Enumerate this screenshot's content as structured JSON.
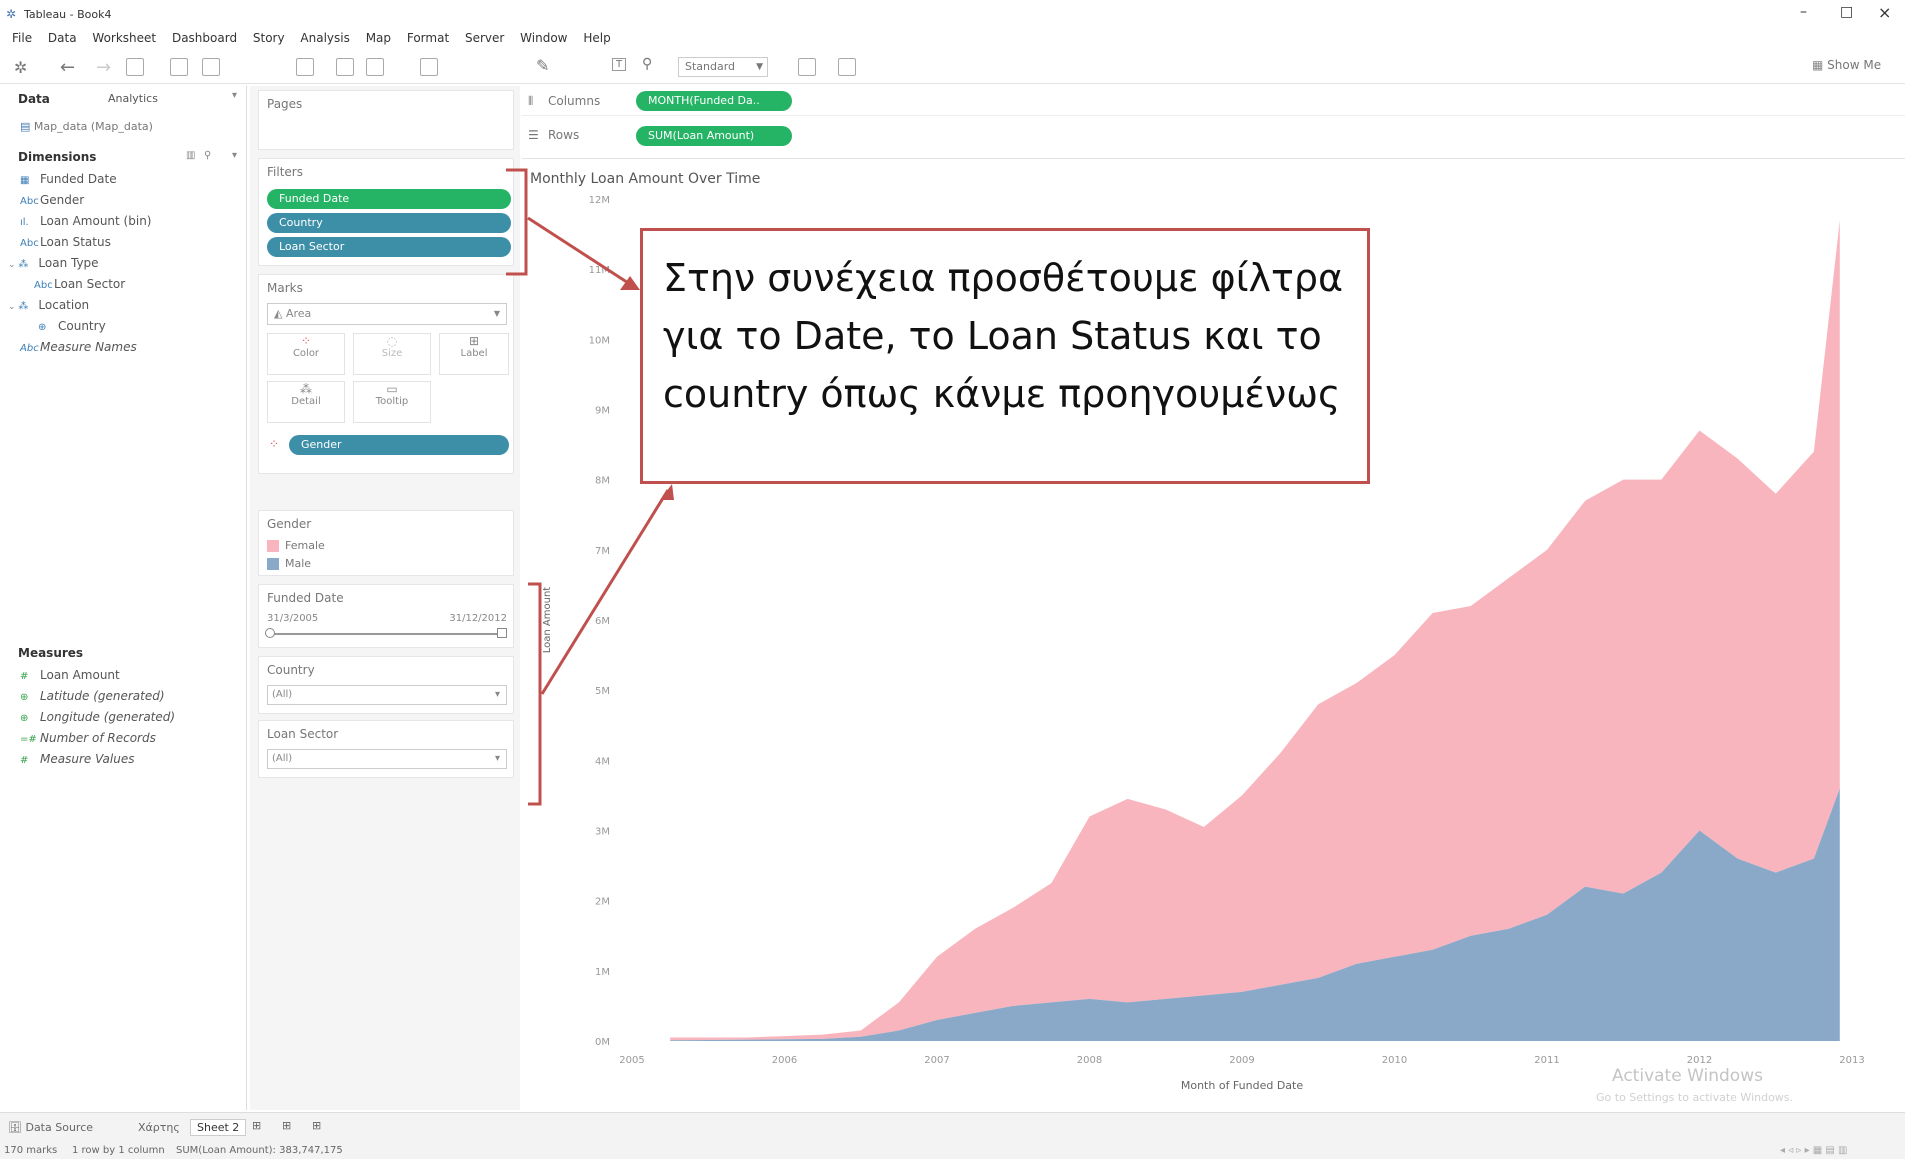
{
  "window": {
    "title": "Tableau - Book4",
    "controls": [
      "–",
      "□",
      "×"
    ]
  },
  "menu": [
    "File",
    "Data",
    "Worksheet",
    "Dashboard",
    "Story",
    "Analysis",
    "Map",
    "Format",
    "Server",
    "Window",
    "Help"
  ],
  "toolbar": {
    "view_select": "Standard",
    "show_me": "Show Me"
  },
  "data_pane": {
    "tab_data": "Data",
    "tab_analytics": "Analytics",
    "source": "Map_data (Map_data)",
    "dimensions_header": "Dimensions",
    "dimensions": [
      "Funded Date",
      "Gender",
      "Loan Amount (bin)",
      "Loan Status",
      "Loan Type",
      "Loan Sector",
      "Location",
      "Country",
      "Measure Names"
    ],
    "measures_header": "Measures",
    "measures": [
      "Loan Amount",
      "Latitude (generated)",
      "Longitude (generated)",
      "Number of Records",
      "Measure Values"
    ]
  },
  "cards": {
    "pages": "Pages",
    "filters": "Filters",
    "filter_pills": [
      "Funded Date",
      "Country",
      "Loan Sector"
    ],
    "marks": "Marks",
    "mark_type": "Area",
    "mark_buttons": [
      "Color",
      "Size",
      "Label",
      "Detail",
      "Tooltip"
    ],
    "gender_pill": "Gender",
    "gender_legend_title": "Gender",
    "gender_legend": [
      "Female",
      "Male"
    ],
    "funded_title": "Funded Date",
    "funded_from": "31/3/2005",
    "funded_to": "31/12/2012",
    "country_title": "Country",
    "country_value": "(All)",
    "sector_title": "Loan Sector",
    "sector_value": "(All)"
  },
  "shelves": {
    "columns_label": "Columns",
    "columns_pill": "MONTH(Funded Da..",
    "rows_label": "Rows",
    "rows_pill": "SUM(Loan Amount)"
  },
  "annotation": {
    "text": "Στην συνέχεια προσθέτουμε φίλτρα για το Date, το Loan Status και το country όπως κάνμε προηγουμένως"
  },
  "watermark": {
    "line1": "Activate Windows",
    "line2": "Go to Settings to activate Windows."
  },
  "status": {
    "data_source": "Data Source",
    "sheet1": "Χάρτης",
    "sheet2": "Sheet 2",
    "marks": "170 marks",
    "rows": "1 row by 1 column",
    "sum": "SUM(Loan Amount): 383,747,175"
  },
  "colors": {
    "female": "#f9b5bd",
    "male": "#8aa9c9",
    "pill_green": "#25b466",
    "pill_blue": "#3d8fa8",
    "callout_border": "#c0504d"
  },
  "chart_data": {
    "type": "area",
    "title": "Monthly Loan Amount Over Time",
    "xlabel": "Month of Funded Date",
    "ylabel": "Loan Amount",
    "x_ticks": [
      "2005",
      "2006",
      "2007",
      "2008",
      "2009",
      "2010",
      "2011",
      "2012",
      "2013"
    ],
    "y_ticks": [
      "0M",
      "1M",
      "2M",
      "3M",
      "4M",
      "5M",
      "6M",
      "7M",
      "8M",
      "9M",
      "10M",
      "11M",
      "12M"
    ],
    "ylim": [
      0,
      12000000
    ],
    "xlim": [
      2005.0,
      2013.0
    ],
    "stacked": true,
    "series": [
      {
        "name": "Male",
        "x": [
          2005.25,
          2005.5,
          2005.75,
          2006.0,
          2006.25,
          2006.5,
          2006.75,
          2007.0,
          2007.25,
          2007.5,
          2007.75,
          2008.0,
          2008.25,
          2008.5,
          2008.75,
          2009.0,
          2009.25,
          2009.5,
          2009.75,
          2010.0,
          2010.25,
          2010.5,
          2010.75,
          2011.0,
          2011.25,
          2011.5,
          2011.75,
          2012.0,
          2012.25,
          2012.5,
          2012.75,
          2012.92
        ],
        "values": [
          10000,
          15000,
          20000,
          25000,
          30000,
          60000,
          150000,
          300000,
          400000,
          500000,
          550000,
          600000,
          550000,
          600000,
          650000,
          700000,
          800000,
          900000,
          1100000,
          1200000,
          1300000,
          1500000,
          1600000,
          1800000,
          2200000,
          2100000,
          2400000,
          3000000,
          2600000,
          2400000,
          2600000,
          3600000
        ]
      },
      {
        "name": "Female",
        "x": [
          2005.25,
          2005.5,
          2005.75,
          2006.0,
          2006.25,
          2006.5,
          2006.75,
          2007.0,
          2007.25,
          2007.5,
          2007.75,
          2008.0,
          2008.25,
          2008.5,
          2008.75,
          2009.0,
          2009.25,
          2009.5,
          2009.75,
          2010.0,
          2010.25,
          2010.5,
          2010.75,
          2011.0,
          2011.25,
          2011.5,
          2011.75,
          2012.0,
          2012.25,
          2012.5,
          2012.75,
          2012.92
        ],
        "values": [
          40000,
          35000,
          30000,
          45000,
          60000,
          90000,
          400000,
          900000,
          1200000,
          1400000,
          1700000,
          2600000,
          2900000,
          2700000,
          2400000,
          2800000,
          3300000,
          3900000,
          4000000,
          4300000,
          4800000,
          4700000,
          5000000,
          5200000,
          5500000,
          5900000,
          5600000,
          5700000,
          5700000,
          5400000,
          5800000,
          8100000
        ]
      }
    ],
    "legend_position": "left-card",
    "grid": false
  }
}
